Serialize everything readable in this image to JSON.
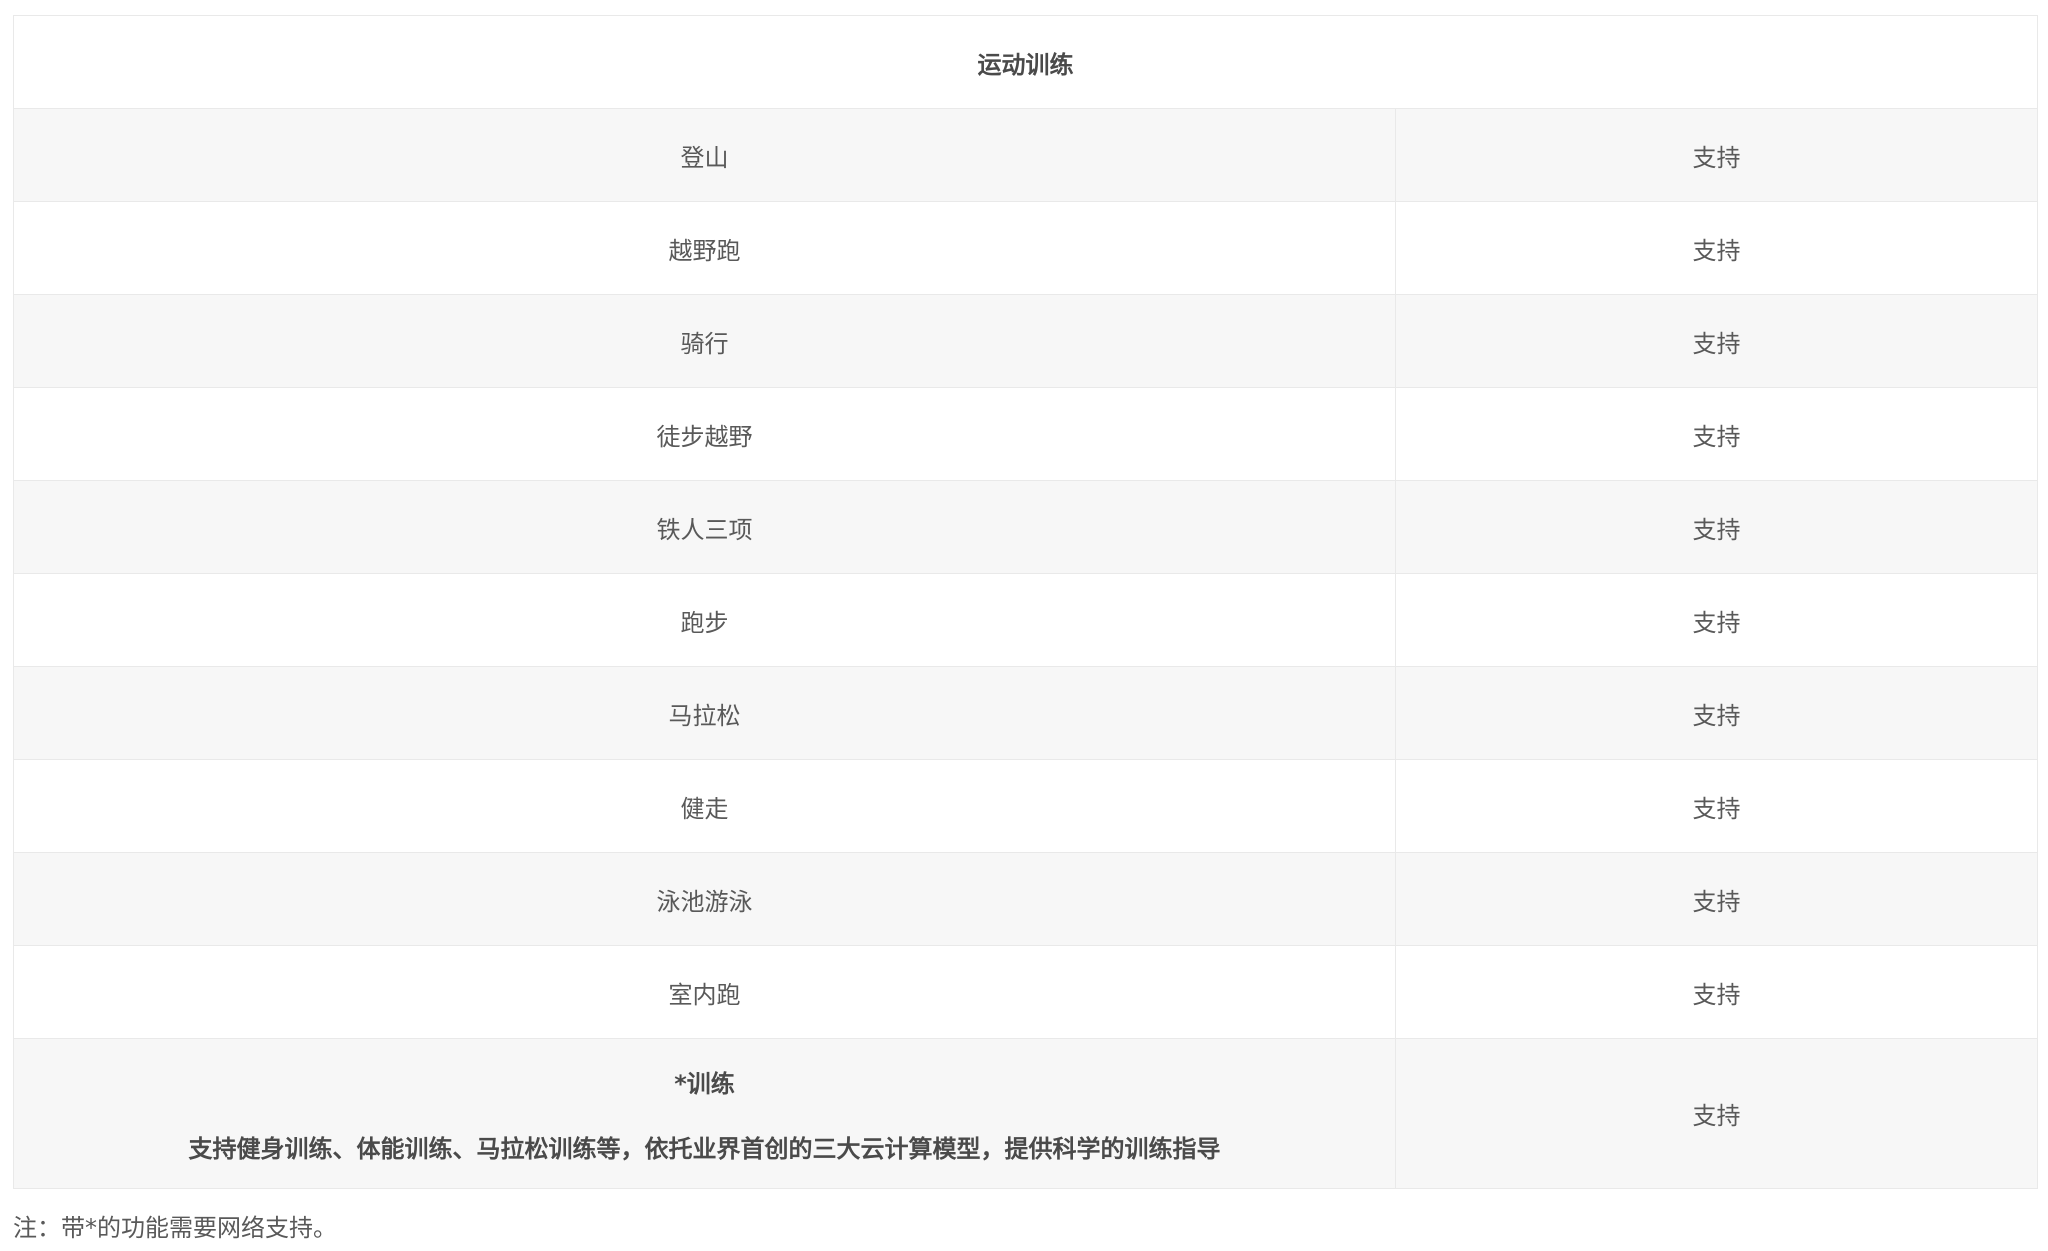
{
  "table": {
    "header": "运动训练",
    "rows": [
      {
        "name": "登山",
        "value": "支持"
      },
      {
        "name": "越野跑",
        "value": "支持"
      },
      {
        "name": "骑行",
        "value": "支持"
      },
      {
        "name": "徒步越野",
        "value": "支持"
      },
      {
        "name": "铁人三项",
        "value": "支持"
      },
      {
        "name": "跑步",
        "value": "支持"
      },
      {
        "name": "马拉松",
        "value": "支持"
      },
      {
        "name": "健走",
        "value": "支持"
      },
      {
        "name": "泳池游泳",
        "value": "支持"
      },
      {
        "name": "室内跑",
        "value": "支持"
      }
    ],
    "last_row": {
      "title": "*训练",
      "description": "支持健身训练、体能训练、马拉松训练等，依托业界首创的三大云计算模型，提供科学的训练指导",
      "value": "支持"
    }
  },
  "footnote": "注：带*的功能需要网络支持。"
}
